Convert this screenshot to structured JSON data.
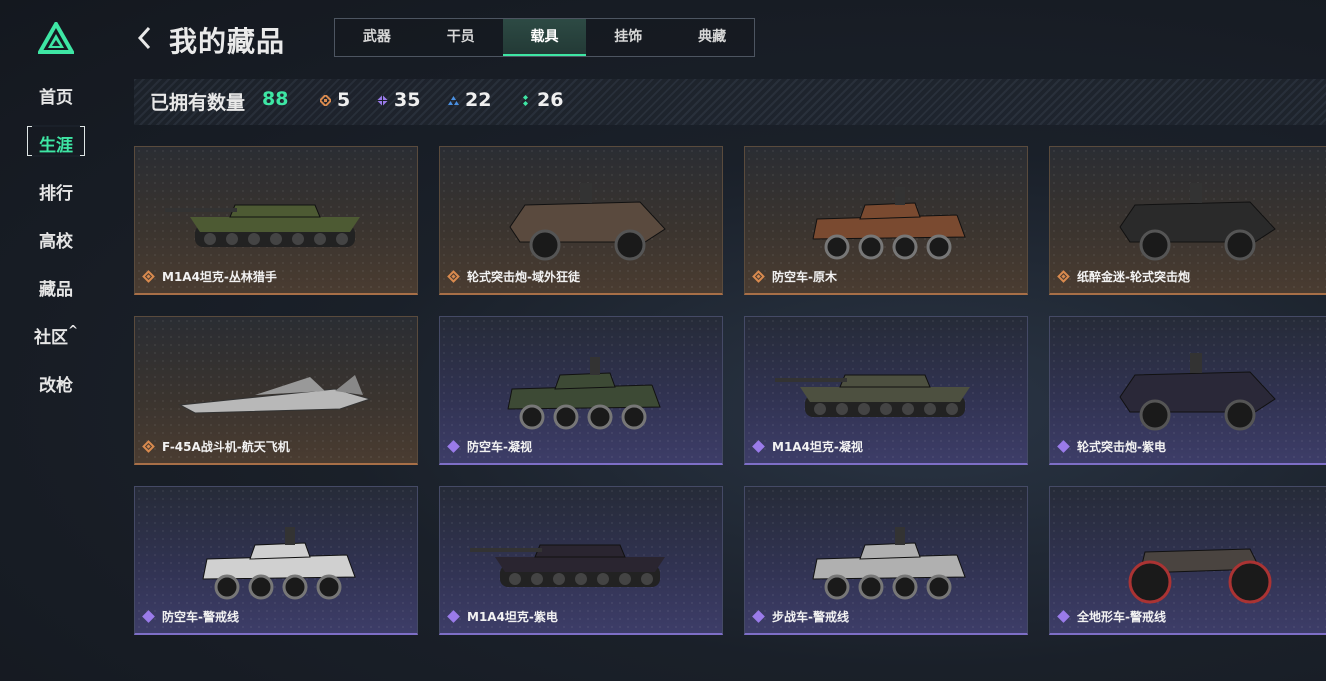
{
  "sidebar": {
    "items": [
      {
        "label": "首页"
      },
      {
        "label": "生涯"
      },
      {
        "label": "排行"
      },
      {
        "label": "高校"
      },
      {
        "label": "藏品"
      },
      {
        "label": "社区"
      },
      {
        "label": "改枪"
      }
    ],
    "active_index": 1,
    "community_chevron": "^"
  },
  "header": {
    "title": "我的藏品",
    "tabs": [
      {
        "label": "武器"
      },
      {
        "label": "干员"
      },
      {
        "label": "载具"
      },
      {
        "label": "挂饰"
      },
      {
        "label": "典藏"
      }
    ],
    "active_tab": 2
  },
  "stats": {
    "label": "已拥有数量",
    "total": "88",
    "rarities": [
      {
        "icon": "orange-rarity-icon",
        "color": "#d98a4e",
        "count": "5"
      },
      {
        "icon": "purple-rarity-icon",
        "color": "#9a7bea",
        "count": "35"
      },
      {
        "icon": "blue-rarity-icon",
        "color": "#4a90e2",
        "count": "22"
      },
      {
        "icon": "green-rarity-icon",
        "color": "#3ee6a4",
        "count": "26"
      }
    ]
  },
  "vehicles": [
    {
      "name": "M1A4坦克-丛林猎手",
      "rarity": "orange"
    },
    {
      "name": "轮式突击炮-域外狂徒",
      "rarity": "orange"
    },
    {
      "name": "防空车-原木",
      "rarity": "orange"
    },
    {
      "name": "纸醉金迷-轮式突击炮",
      "rarity": "orange"
    },
    {
      "name": "F-45A战斗机-航天飞机",
      "rarity": "orange"
    },
    {
      "name": "防空车-凝视",
      "rarity": "purple"
    },
    {
      "name": "M1A4坦克-凝视",
      "rarity": "purple"
    },
    {
      "name": "轮式突击炮-紫电",
      "rarity": "purple"
    },
    {
      "name": "防空车-警戒线",
      "rarity": "purple"
    },
    {
      "name": "M1A4坦克-紫电",
      "rarity": "purple"
    },
    {
      "name": "步战车-警戒线",
      "rarity": "purple"
    },
    {
      "name": "全地形车-警戒线",
      "rarity": "purple"
    }
  ],
  "colors": {
    "accent": "#3ee6a4",
    "orange": "#d98a4e",
    "purple": "#9a7bea"
  }
}
